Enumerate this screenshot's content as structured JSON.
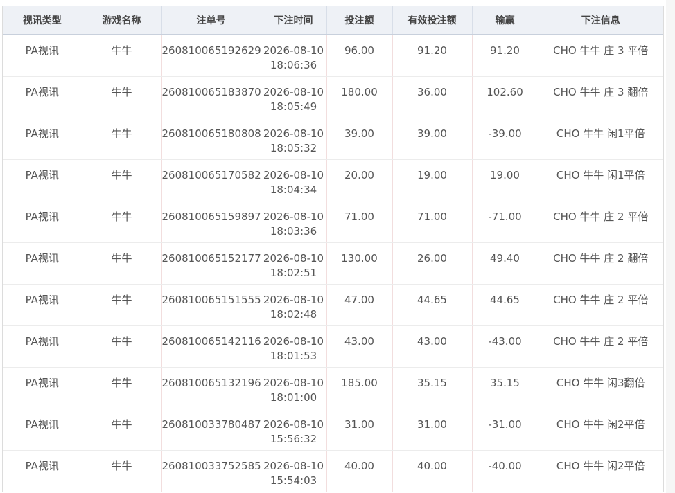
{
  "columns": [
    "视讯类型",
    "游戏名称",
    "注单号",
    "下注时间",
    "投注额",
    "有效投注额",
    "输赢",
    "下注信息"
  ],
  "rows": [
    {
      "type": "PA视讯",
      "game": "牛牛",
      "id": "260810065192629",
      "date": "2026-08-10",
      "time": "18:06:36",
      "bet": "96.00",
      "valid": "91.20",
      "result": "91.20",
      "info": "CHO 牛牛 庄 3 平倍"
    },
    {
      "type": "PA视讯",
      "game": "牛牛",
      "id": "260810065183870",
      "date": "2026-08-10",
      "time": "18:05:49",
      "bet": "180.00",
      "valid": "36.00",
      "result": "102.60",
      "info": "CHO 牛牛 庄 3 翻倍"
    },
    {
      "type": "PA视讯",
      "game": "牛牛",
      "id": "260810065180808",
      "date": "2026-08-10",
      "time": "18:05:32",
      "bet": "39.00",
      "valid": "39.00",
      "result": "-39.00",
      "info": "CHO 牛牛 闲1平倍"
    },
    {
      "type": "PA视讯",
      "game": "牛牛",
      "id": "260810065170582",
      "date": "2026-08-10",
      "time": "18:04:34",
      "bet": "20.00",
      "valid": "19.00",
      "result": "19.00",
      "info": "CHO 牛牛 闲1平倍"
    },
    {
      "type": "PA视讯",
      "game": "牛牛",
      "id": "260810065159897",
      "date": "2026-08-10",
      "time": "18:03:36",
      "bet": "71.00",
      "valid": "71.00",
      "result": "-71.00",
      "info": "CHO 牛牛 庄 2 平倍"
    },
    {
      "type": "PA视讯",
      "game": "牛牛",
      "id": "260810065152177",
      "date": "2026-08-10",
      "time": "18:02:51",
      "bet": "130.00",
      "valid": "26.00",
      "result": "49.40",
      "info": "CHO 牛牛 庄 2 翻倍"
    },
    {
      "type": "PA视讯",
      "game": "牛牛",
      "id": "260810065151555",
      "date": "2026-08-10",
      "time": "18:02:48",
      "bet": "47.00",
      "valid": "44.65",
      "result": "44.65",
      "info": "CHO 牛牛 庄 2 平倍"
    },
    {
      "type": "PA视讯",
      "game": "牛牛",
      "id": "260810065142116",
      "date": "2026-08-10",
      "time": "18:01:53",
      "bet": "43.00",
      "valid": "43.00",
      "result": "-43.00",
      "info": "CHO 牛牛 庄 2 平倍"
    },
    {
      "type": "PA视讯",
      "game": "牛牛",
      "id": "260810065132196",
      "date": "2026-08-10",
      "time": "18:01:00",
      "bet": "185.00",
      "valid": "35.15",
      "result": "35.15",
      "info": "CHO 牛牛 闲3翻倍"
    },
    {
      "type": "PA视讯",
      "game": "牛牛",
      "id": "260810033780487",
      "date": "2026-08-10",
      "time": "15:56:32",
      "bet": "31.00",
      "valid": "31.00",
      "result": "-31.00",
      "info": "CHO 牛牛 闲2平倍"
    },
    {
      "type": "PA视讯",
      "game": "牛牛",
      "id": "260810033752585",
      "date": "2026-08-10",
      "time": "15:54:03",
      "bet": "40.00",
      "valid": "40.00",
      "result": "-40.00",
      "info": "CHO 牛牛 闲2平倍"
    }
  ]
}
